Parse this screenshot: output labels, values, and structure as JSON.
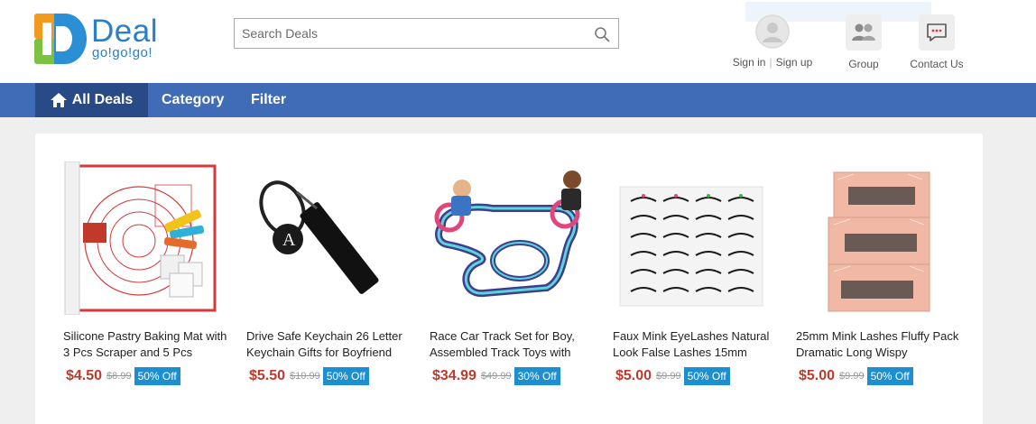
{
  "logo": {
    "word": "Deal",
    "sub": "go!go!go!"
  },
  "search": {
    "placeholder": "Search Deals",
    "value": ""
  },
  "header": {
    "sign_in": "Sign in",
    "sign_up": "Sign up",
    "sign_sep": "|",
    "group": "Group",
    "contact": "Contact Us"
  },
  "nav": {
    "all_deals": "All Deals",
    "category": "Category",
    "filter": "Filter"
  },
  "products": [
    {
      "title": "Silicone Pastry Baking Mat with 3 Pcs Scraper and 5 Pcs",
      "price": "$4.50",
      "original": "$8.99",
      "discount": "50% Off",
      "icon": "baking-mat-image"
    },
    {
      "title": "Drive Safe Keychain 26 Letter Keychain Gifts for Boyfriend",
      "price": "$5.50",
      "original": "$10.99",
      "discount": "50% Off",
      "icon": "keychain-image"
    },
    {
      "title": "Race Car Track Set for Boy, Assembled Track Toys with",
      "price": "$34.99",
      "original": "$49.99",
      "discount": "30% Off",
      "icon": "race-track-image"
    },
    {
      "title": "Faux Mink EyeLashes Natural Look False Lashes 15mm",
      "price": "$5.00",
      "original": "$9.99",
      "discount": "50% Off",
      "icon": "eyelashes-image"
    },
    {
      "title": "25mm Mink Lashes Fluffy Pack Dramatic Long Wispy",
      "price": "$5.00",
      "original": "$9.99",
      "discount": "50% Off",
      "icon": "lash-boxes-image"
    }
  ],
  "colors": {
    "nav": "#3f6bb7",
    "nav_active": "#284a86",
    "price": "#c0392b",
    "badge": "#1b8fd0",
    "brand": "#2b7fc9"
  }
}
